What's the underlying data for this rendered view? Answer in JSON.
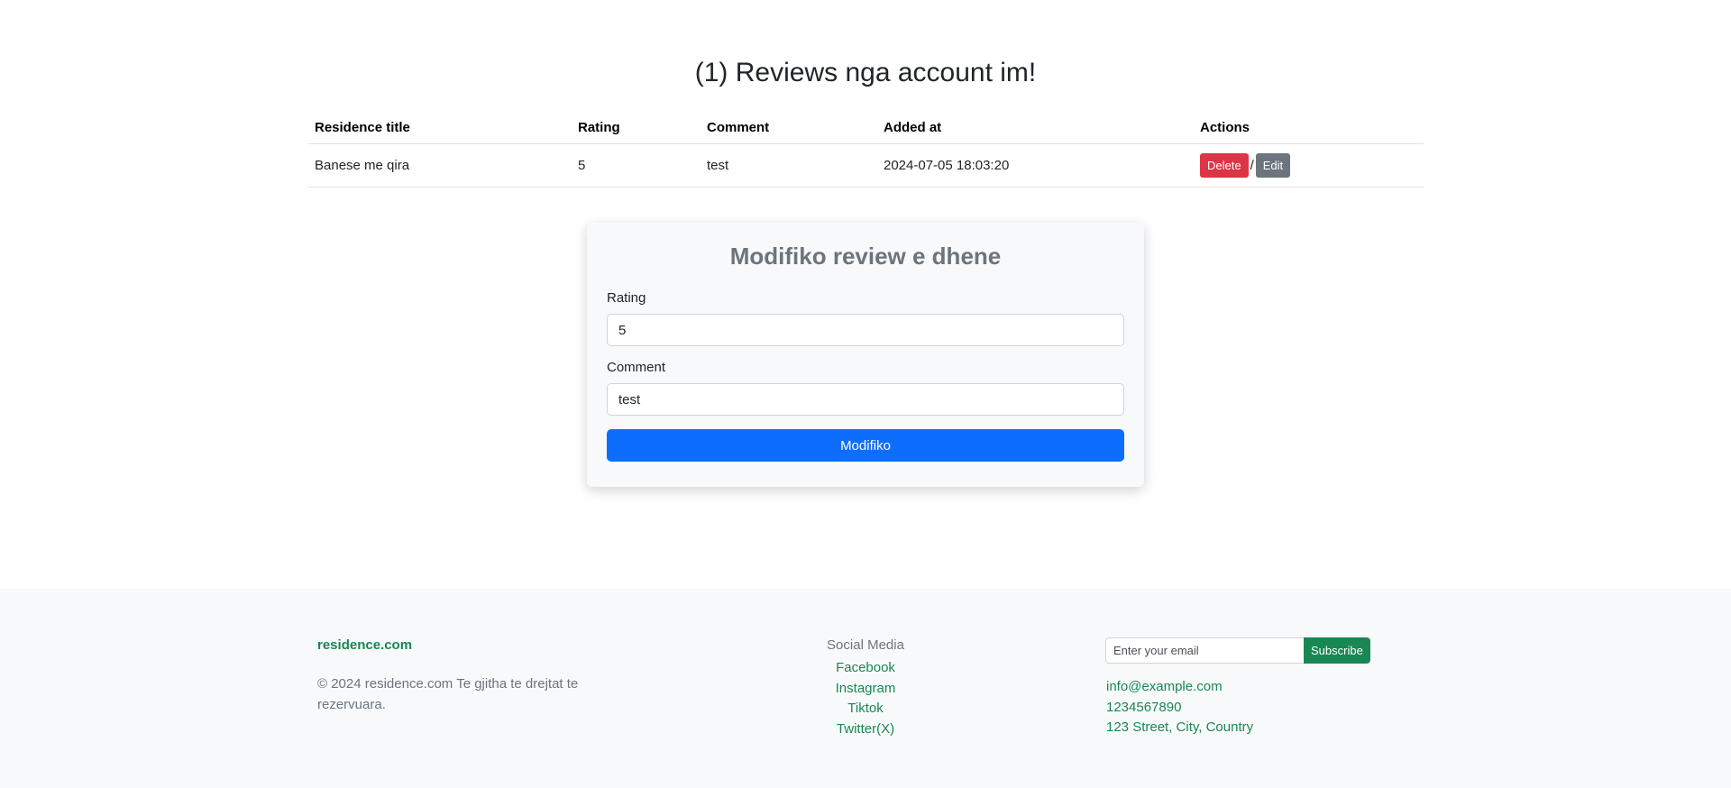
{
  "page": {
    "title": "(1) Reviews nga account im!"
  },
  "table": {
    "headers": [
      "Residence title",
      "Rating",
      "Comment",
      "Added at",
      "Actions"
    ],
    "rows": [
      {
        "residence_title": "Banese me qira",
        "rating": "5",
        "comment": "test",
        "added_at": "2024-07-05 18:03:20",
        "delete_label": "Delete",
        "separator": "/",
        "edit_label": "Edit"
      }
    ]
  },
  "edit_form": {
    "title": "Modifiko review e dhene",
    "rating_label": "Rating",
    "rating_value": "5",
    "comment_label": "Comment",
    "comment_value": "test",
    "submit_label": "Modifiko"
  },
  "footer": {
    "brand": "residence.com",
    "copyright": "© 2024 residence.com Te gjitha te drejtat te rezervuara.",
    "social_title": "Social Media",
    "social_links": [
      "Facebook",
      "Instagram",
      "Tiktok",
      "Twitter(X)"
    ],
    "email_placeholder": "Enter your email",
    "subscribe_label": "Subscribe",
    "contact": {
      "email": "info@example.com",
      "phone": "1234567890",
      "address": "123 Street, City, Country"
    }
  },
  "colors": {
    "primary": "#0d6efd",
    "danger": "#dc3545",
    "secondary": "#6c757d",
    "success": "#198754",
    "light_bg": "#f8f9fa"
  }
}
